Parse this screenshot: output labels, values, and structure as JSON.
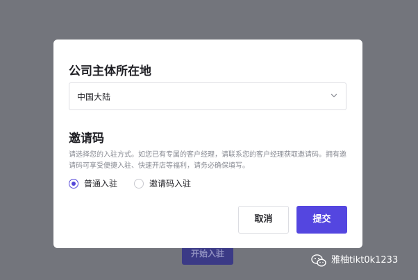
{
  "background": {
    "start_button_label": "开始入驻"
  },
  "dialog": {
    "region_title": "公司主体所在地",
    "region_select": {
      "value": "中国大陆",
      "icon": "chevron-down-icon"
    },
    "invite_title": "邀请码",
    "invite_description": "请选择您的入驻方式。如您已有专属的客户经理，请联系您的客户经理获取邀请码。拥有邀请码可享受便捷入驻、快速开店等福利，请务必确保填写。",
    "options": [
      {
        "label": "普通入驻",
        "selected": true
      },
      {
        "label": "邀请码入驻",
        "selected": false
      }
    ],
    "cancel_label": "取消",
    "submit_label": "提交"
  },
  "watermark": {
    "icon": "wechat-icon",
    "text": "雅柚tikt0k1233"
  },
  "colors": {
    "overlay": "#73757c",
    "accent": "#5446e0",
    "dialog_bg": "#ffffff"
  }
}
